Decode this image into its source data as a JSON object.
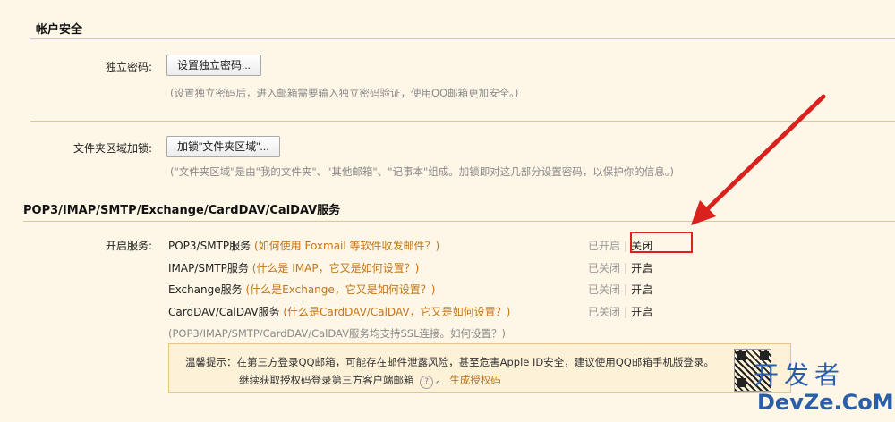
{
  "account_security": {
    "title": "帐户安全",
    "independent_password": {
      "label": "独立密码:",
      "button": "设置独立密码...",
      "hint": "(设置独立密码后，进入邮箱需要输入独立密码验证，使用QQ邮箱更加安全。)"
    },
    "folder_lock": {
      "label": "文件夹区域加锁:",
      "button": "加锁\"文件夹区域\"...",
      "hint": "(\"文件夹区域\"是由\"我的文件夹\"、\"其他邮箱\"、\"记事本\"组成。加锁即对这几部分设置密码，以保护你的信息。)"
    }
  },
  "protocols": {
    "title": "POP3/IMAP/SMTP/Exchange/CardDAV/CalDAV服务",
    "label": "开启服务:",
    "services": [
      {
        "name": "POP3/SMTP服务",
        "link": "(如何使用 Foxmail 等软件收发邮件？)",
        "status": "已开启",
        "action": "关闭"
      },
      {
        "name": "IMAP/SMTP服务",
        "link": "(什么是 IMAP，它又是如何设置？)",
        "status": "已关闭",
        "action": "开启"
      },
      {
        "name": "Exchange服务",
        "link": "(什么是Exchange，它又是如何设置？)",
        "status": "已关闭",
        "action": "开启"
      },
      {
        "name": "CardDAV/CalDAV服务",
        "link": "(什么是CardDAV/CalDAV，它又是如何设置？)",
        "status": "已关闭",
        "action": "开启"
      }
    ],
    "ssl_note": "(POP3/IMAP/SMTP/CardDAV/CalDAV服务均支持SSL连接。",
    "ssl_link": "如何设置？",
    "ssl_close": ")",
    "separator": "|"
  },
  "tip": {
    "line1": "温馨提示：在第三方登录QQ邮箱，可能存在邮件泄露风险，甚至危害Apple ID安全，建议使用QQ邮箱手机版登录。",
    "line2_prefix": "继续获取授权码登录第三方客户端邮箱",
    "help_glyph": "?",
    "line2_link": "生成授权码",
    "line2_mid": "。"
  },
  "watermark": {
    "cn": "开发者",
    "en": "DevZe.CoM"
  },
  "colors": {
    "background": "#fef6e6",
    "link": "#c1761a",
    "highlight": "#d9211d",
    "arrow": "#d9211d"
  }
}
